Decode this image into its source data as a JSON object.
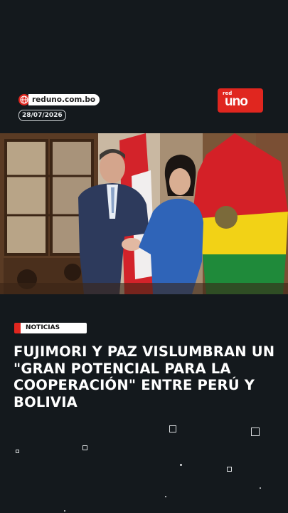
{
  "source": {
    "website": "reduno.com.bo",
    "date": "28/07/2026"
  },
  "brand": {
    "logo_small": "red",
    "logo_main": "uno"
  },
  "article": {
    "category": "NOTICIAS",
    "headline": "FUJIMORI Y PAZ VISLUMBRAN UN \"GRAN POTENCIAL PARA LA COOPERACIÓN\" ENTRE PERÚ Y BOLIVIA"
  },
  "colors": {
    "background": "#14191d",
    "accent": "#e0261f",
    "text": "#ffffff"
  },
  "icons": {
    "source": "globe-icon"
  }
}
